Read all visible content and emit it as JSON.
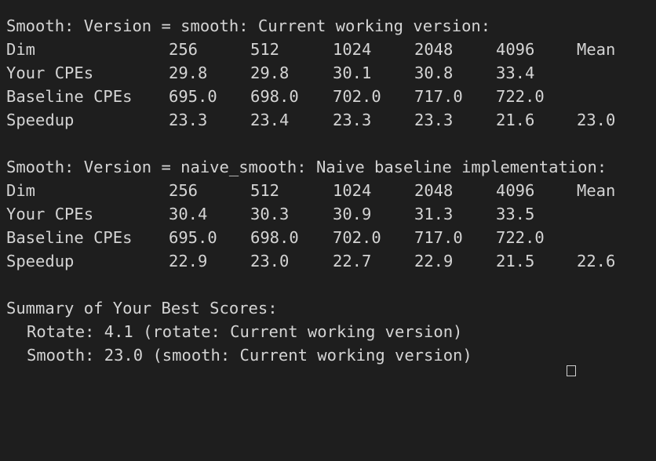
{
  "sections": [
    {
      "header": "Smooth: Version = smooth: Current working version:",
      "rows": [
        [
          "Dim",
          "256",
          "512",
          "1024",
          "2048",
          "4096",
          "Mean"
        ],
        [
          "Your CPEs",
          "29.8",
          "29.8",
          "30.1",
          "30.8",
          "33.4",
          ""
        ],
        [
          "Baseline CPEs",
          "695.0",
          "698.0",
          "702.0",
          "717.0",
          "722.0",
          ""
        ],
        [
          "Speedup",
          "23.3",
          "23.4",
          "23.3",
          "23.3",
          "21.6",
          "23.0"
        ]
      ]
    },
    {
      "header": "Smooth: Version = naive_smooth: Naive baseline implementation:",
      "rows": [
        [
          "Dim",
          "256",
          "512",
          "1024",
          "2048",
          "4096",
          "Mean"
        ],
        [
          "Your CPEs",
          "30.4",
          "30.3",
          "30.9",
          "31.3",
          "33.5",
          ""
        ],
        [
          "Baseline CPEs",
          "695.0",
          "698.0",
          "702.0",
          "717.0",
          "722.0",
          ""
        ],
        [
          "Speedup",
          "22.9",
          "23.0",
          "22.7",
          "22.9",
          "21.5",
          "22.6"
        ]
      ]
    }
  ],
  "summary": {
    "title": "Summary of Your Best Scores:",
    "lines": [
      "Rotate: 4.1 (rotate: Current working version)",
      "Smooth: 23.0 (smooth: Current working version)"
    ]
  },
  "colors": {
    "background": "#1e1e1e",
    "text": "#d4d4d4"
  }
}
